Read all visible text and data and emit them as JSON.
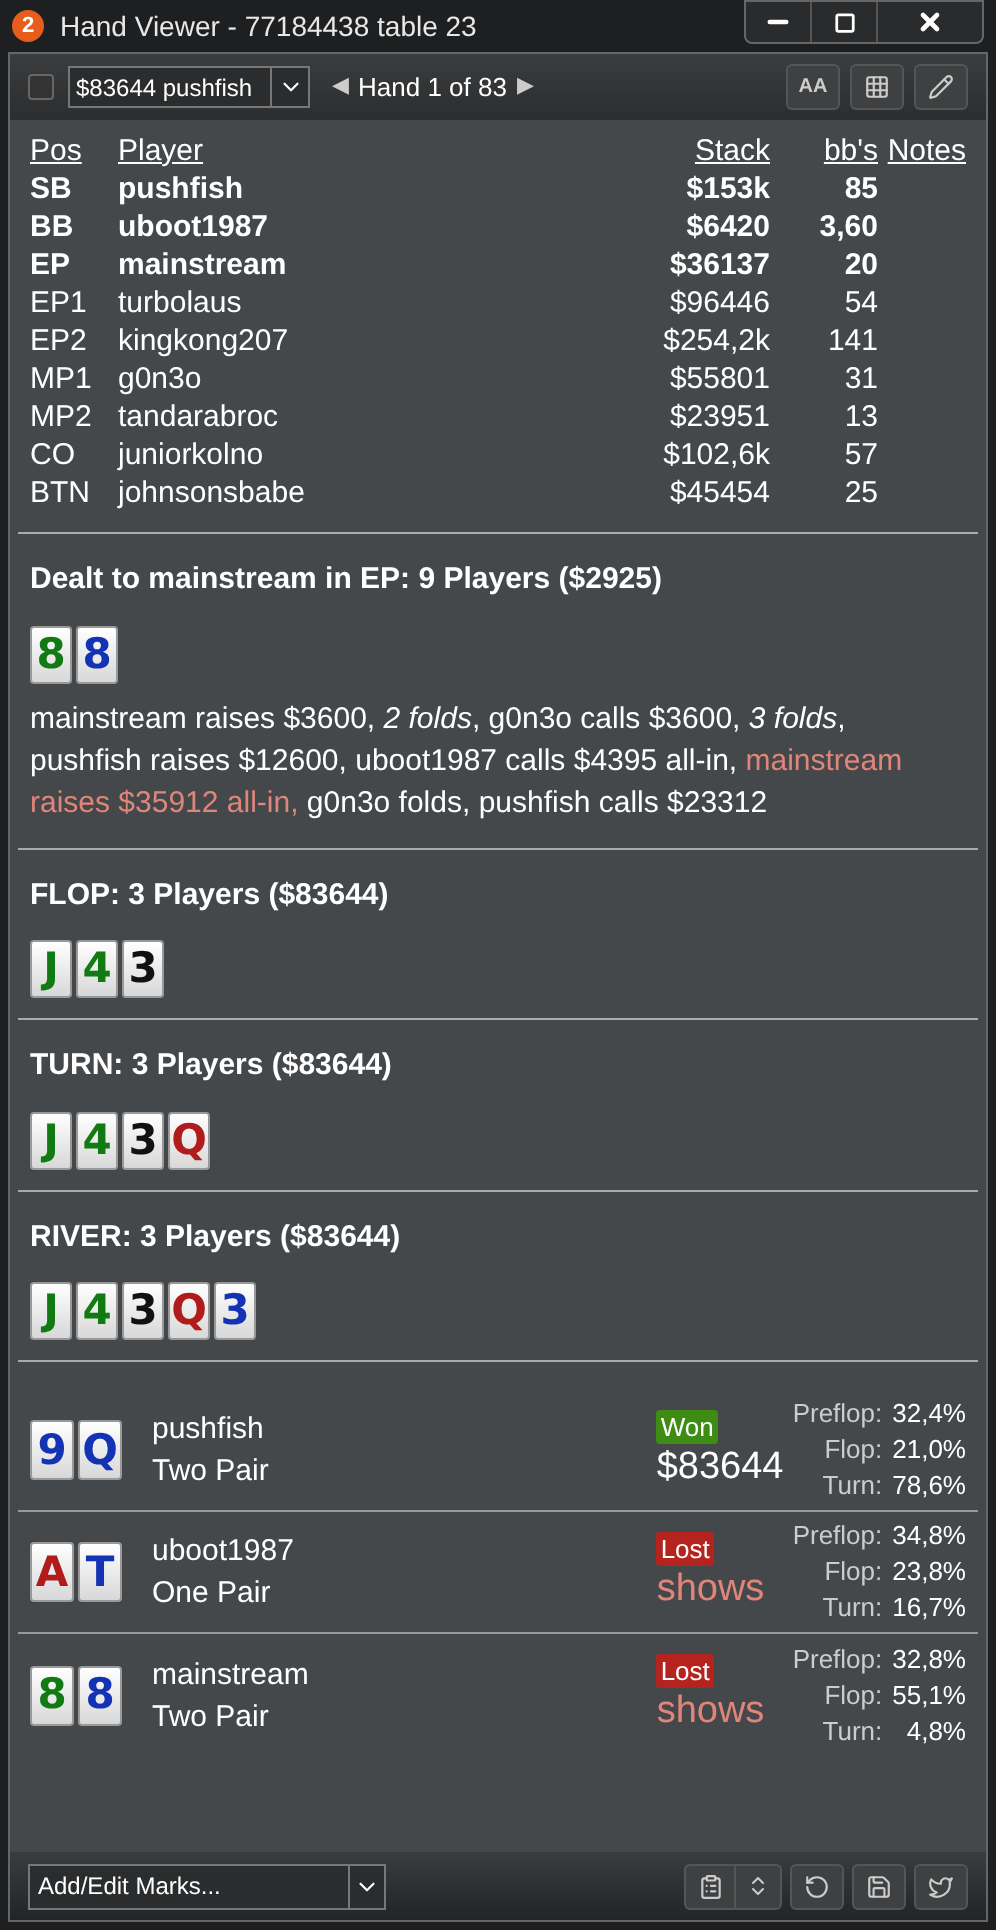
{
  "window": {
    "badge": "2",
    "title": "Hand Viewer - 77184438 table 23"
  },
  "toolbar": {
    "checked": false,
    "player_select": "$83644 pushfish",
    "prev": "◀",
    "hand_nav": "Hand 1 of 83",
    "next": "▶",
    "font_button": "AA"
  },
  "table": {
    "columns": [
      "Pos",
      "Player",
      "Stack",
      "bb's",
      "Notes"
    ],
    "rows": [
      {
        "pos": "SB",
        "player": "pushfish",
        "stack": "$153k",
        "bbs": "85",
        "bold": true
      },
      {
        "pos": "BB",
        "player": "uboot1987",
        "stack": "$6420",
        "bbs": "3,60",
        "bold": true
      },
      {
        "pos": "EP",
        "player": "mainstream",
        "stack": "$36137",
        "bbs": "20",
        "bold": true
      },
      {
        "pos": "EP1",
        "player": "turbolaus",
        "stack": "$96446",
        "bbs": "54",
        "bold": false
      },
      {
        "pos": "EP2",
        "player": "kingkong207",
        "stack": "$254,2k",
        "bbs": "141",
        "bold": false
      },
      {
        "pos": "MP1",
        "player": "g0n3o",
        "stack": "$55801",
        "bbs": "31",
        "bold": false
      },
      {
        "pos": "MP2",
        "player": "tandarabroc",
        "stack": "$23951",
        "bbs": "13",
        "bold": false
      },
      {
        "pos": "CO",
        "player": "juniorkolno",
        "stack": "$102,6k",
        "bbs": "57",
        "bold": false
      },
      {
        "pos": "BTN",
        "player": "johnsonsbabe",
        "stack": "$45454",
        "bbs": "25",
        "bold": false
      }
    ]
  },
  "streets": [
    {
      "title": "Dealt to mainstream in EP: 9 Players ($2925)",
      "cards": [
        {
          "rank": "8",
          "color": "#127a12"
        },
        {
          "rank": "8",
          "color": "#1432b4"
        }
      ],
      "actions": [
        {
          "kind": "plain",
          "text": "mainstream raises $3600, "
        },
        {
          "kind": "italic",
          "text": "2 folds"
        },
        {
          "kind": "plain",
          "text": ", g0n3o calls $3600, "
        },
        {
          "kind": "italic",
          "text": "3 folds"
        },
        {
          "kind": "plain",
          "text": ", pushfish raises $12600, uboot1987 calls $4395 all-in, "
        },
        {
          "kind": "highlight",
          "text": "mainstream raises $35912 all-in,"
        },
        {
          "kind": "plain",
          "text": " g0n3o folds, pushfish calls $23312"
        }
      ]
    },
    {
      "title": "FLOP: 3 Players ($83644)",
      "cards": [
        {
          "rank": "J",
          "color": "#127a12"
        },
        {
          "rank": "4",
          "color": "#127a12"
        },
        {
          "rank": "3",
          "color": "#111111"
        }
      ]
    },
    {
      "title": "TURN: 3 Players ($83644)",
      "cards": [
        {
          "rank": "J",
          "color": "#127a12"
        },
        {
          "rank": "4",
          "color": "#127a12"
        },
        {
          "rank": "3",
          "color": "#111111"
        },
        {
          "rank": "Q",
          "color": "#b01c1c"
        }
      ]
    },
    {
      "title": "RIVER: 3 Players ($83644)",
      "cards": [
        {
          "rank": "J",
          "color": "#127a12"
        },
        {
          "rank": "4",
          "color": "#127a12"
        },
        {
          "rank": "3",
          "color": "#111111"
        },
        {
          "rank": "Q",
          "color": "#b01c1c"
        },
        {
          "rank": "3",
          "color": "#1432b4"
        }
      ]
    }
  ],
  "results": [
    {
      "cards": [
        {
          "rank": "9",
          "color": "#1432b4"
        },
        {
          "rank": "Q",
          "color": "#1432b4"
        }
      ],
      "player": "pushfish",
      "hand": "Two Pair",
      "won": true,
      "status": "Won",
      "amount": "$83644",
      "equity": [
        {
          "label": "Preflop:",
          "value": "32,4%"
        },
        {
          "label": "Flop:",
          "value": "21,0%"
        },
        {
          "label": "Turn:",
          "value": "78,6%"
        }
      ]
    },
    {
      "cards": [
        {
          "rank": "A",
          "color": "#b01c1c"
        },
        {
          "rank": "T",
          "color": "#1432b4"
        }
      ],
      "player": "uboot1987",
      "hand": "One Pair",
      "won": false,
      "status": "Lost",
      "amount": "shows",
      "equity": [
        {
          "label": "Preflop:",
          "value": "34,8%"
        },
        {
          "label": "Flop:",
          "value": "23,8%"
        },
        {
          "label": "Turn:",
          "value": "16,7%"
        }
      ]
    },
    {
      "cards": [
        {
          "rank": "8",
          "color": "#127a12"
        },
        {
          "rank": "8",
          "color": "#1432b4"
        }
      ],
      "player": "mainstream",
      "hand": "Two Pair",
      "won": false,
      "status": "Lost",
      "amount": "shows",
      "equity": [
        {
          "label": "Preflop:",
          "value": "32,8%"
        },
        {
          "label": "Flop:",
          "value": "55,1%"
        },
        {
          "label": "Turn:",
          "value": "4,8%"
        }
      ]
    }
  ],
  "footer": {
    "marks_select": "Add/Edit Marks..."
  }
}
